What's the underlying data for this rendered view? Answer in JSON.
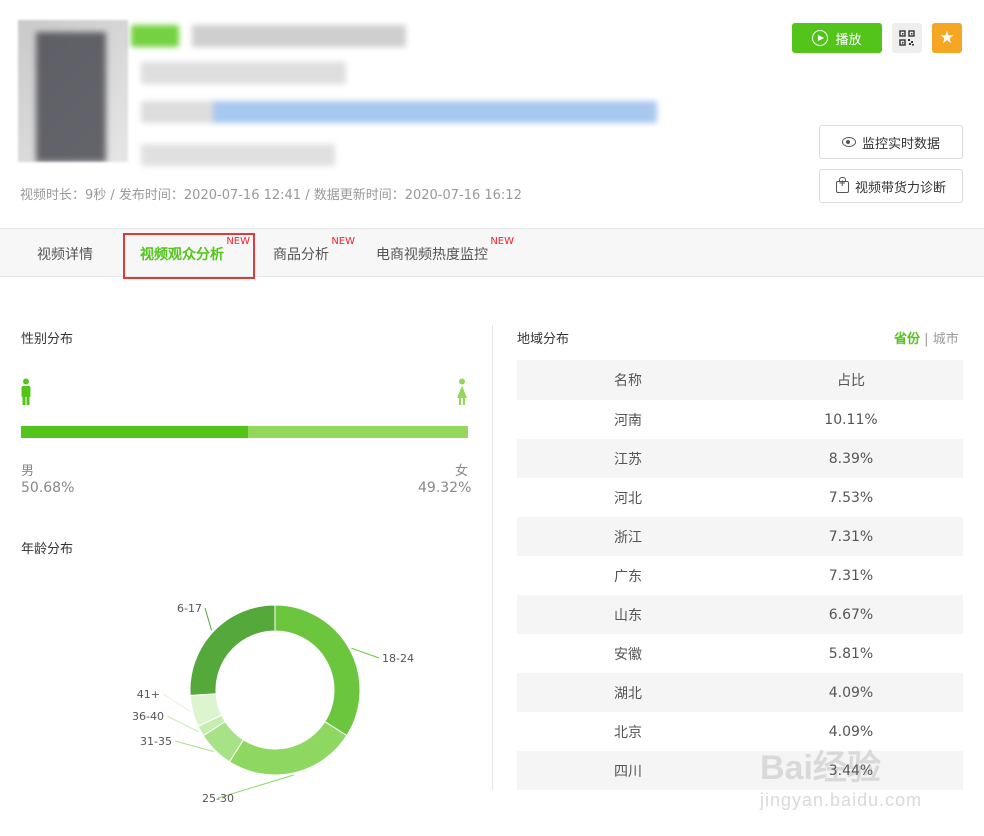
{
  "header": {
    "meta": "视频时长：9秒 / 发布时间：2020-07-16 12:41 / 数据更新时间：2020-07-16 16:12",
    "play_label": "播放",
    "monitor_label": "监控实时数据",
    "diagnose_label": "视频带货力诊断",
    "colors": {
      "accent": "#52c41a",
      "star": "#f5a623"
    }
  },
  "tabs": [
    {
      "label": "视频详情",
      "badge": ""
    },
    {
      "label": "视频观众分析",
      "badge": "NEW"
    },
    {
      "label": "商品分析",
      "badge": "NEW"
    },
    {
      "label": "电商视频热度监控",
      "badge": "NEW"
    }
  ],
  "gender": {
    "title": "性别分布",
    "male_label": "男",
    "male_value": "50.68%",
    "female_label": "女",
    "female_value": "49.32%",
    "male_fraction": 0.5068
  },
  "age": {
    "title": "年龄分布"
  },
  "chart_data": {
    "type": "pie",
    "categories": [
      "18-24",
      "25-30",
      "31-35",
      "36-40",
      "41+",
      "6-17"
    ],
    "values": [
      34,
      25,
      7,
      2,
      6,
      26
    ],
    "colors": [
      "#6cc63d",
      "#8ed862",
      "#a8e287",
      "#c7eeb1",
      "#ddf5cf",
      "#55a83a"
    ]
  },
  "region": {
    "title": "地域分布",
    "switch_on": "省份",
    "switch_sep": "|",
    "switch_off": "城市",
    "columns": [
      "名称",
      "占比"
    ],
    "rows": [
      [
        "河南",
        "10.11%"
      ],
      [
        "江苏",
        "8.39%"
      ],
      [
        "河北",
        "7.53%"
      ],
      [
        "浙江",
        "7.31%"
      ],
      [
        "广东",
        "7.31%"
      ],
      [
        "山东",
        "6.67%"
      ],
      [
        "安徽",
        "5.81%"
      ],
      [
        "湖北",
        "4.09%"
      ],
      [
        "北京",
        "4.09%"
      ],
      [
        "四川",
        "3.44%"
      ]
    ]
  },
  "watermark": {
    "line1": "Bai经验",
    "line2": "jingyan.baidu.com"
  }
}
